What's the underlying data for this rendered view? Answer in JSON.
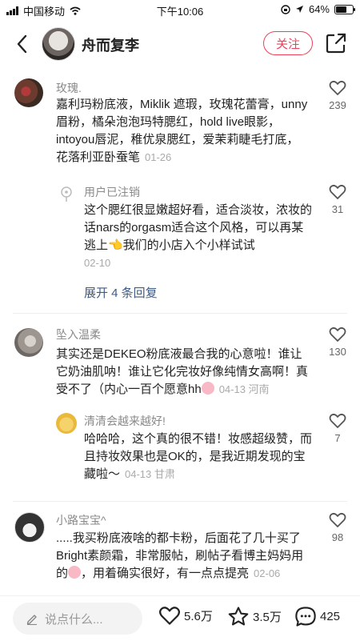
{
  "status_bar": {
    "carrier": "中国移动",
    "time": "下午10:06",
    "battery": "64%",
    "battery_level": 0.64
  },
  "header": {
    "author_name": "舟而复李",
    "follow_label": "关注"
  },
  "comments": [
    {
      "name": "玫瑰.",
      "text": "嘉利玛粉底液，Miklik 遮瑕，玫瑰花蕾膏，unny眉粉，橘朵泡泡玛特腮红，hold live眼影，intoyou唇泥，稚优泉腮红，爱茉莉睫毛打底，花落利亚卧蚕笔",
      "date": "01-26",
      "likes": "239"
    },
    {
      "name": "用户已注销",
      "text": "这个腮红很显嫩超好看，适合淡妆，浓妆的话nars的orgasm适合这个风格，可以再某逃上👈我们的小店入个小样试试",
      "date": "02-10",
      "likes": "31"
    },
    {
      "name": "坠入温柔",
      "text": "其实还是DEKEO粉底液最合我的心意啦！谁让它奶油肌呐！谁让它化完妆好像纯情女高啊！真受不了（内心一百个愿意hh",
      "date": "04-13 河南",
      "likes": "130"
    },
    {
      "name": "清清会越来越好!",
      "text": "哈哈哈，这个真的很不错！妆感超级赞，而且持妆效果也是OK的，是我近期发现的宝藏啦～",
      "date": "04-13 甘肃",
      "likes": "7"
    },
    {
      "name": "小路宝宝^",
      "text": ".....我买粉底液啥的都卡粉，后面花了几十买了Bright素颜霜，非常服帖，刷帖子看博主妈妈用的",
      "text_tail": "，用着确实很好，有一点点提亮",
      "date": "02-06",
      "likes": "98"
    }
  ],
  "expand_replies": "展开 4 条回复",
  "bottom_bar": {
    "input_placeholder": "说点什么...",
    "likes": "5.6万",
    "stars": "3.5万",
    "comments": "425"
  },
  "colors": {
    "accent": "#f0405b",
    "link": "#3d5b86",
    "muted": "#8a8a8a"
  }
}
